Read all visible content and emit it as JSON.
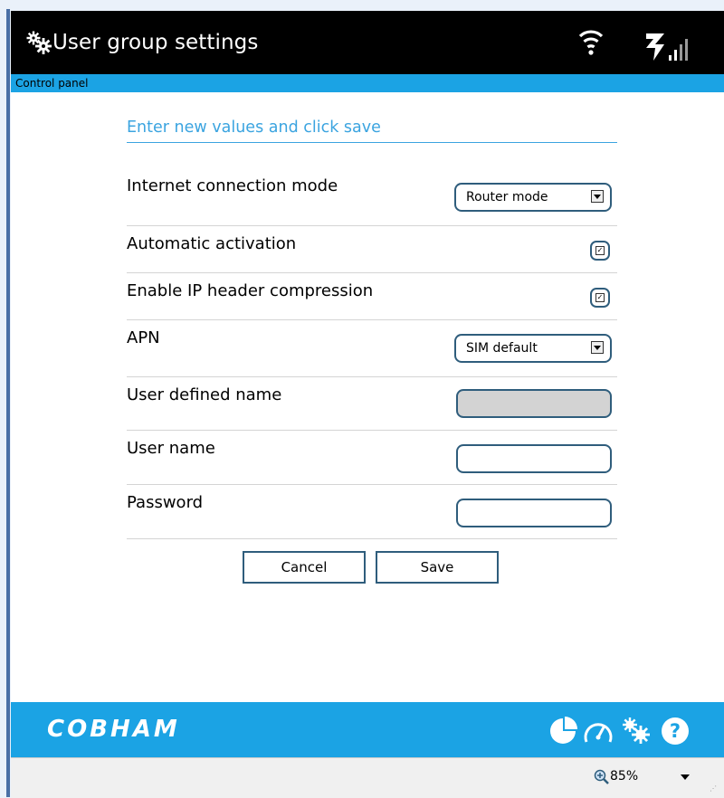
{
  "header": {
    "title": "User group settings",
    "gear_icon": "gear-icon",
    "wifi_icon": "wifi-icon",
    "signal_icon": "signal-strength-icon"
  },
  "control_panel": {
    "label": "Control panel"
  },
  "form": {
    "heading": "Enter new values and click save",
    "internet_mode": {
      "label": "Internet connection mode",
      "value": "Router mode"
    },
    "auto_activation": {
      "label": "Automatic activation",
      "checked": true
    },
    "ip_header_compression": {
      "label": "Enable IP header compression",
      "checked": true
    },
    "apn": {
      "label": "APN",
      "value": "SIM default"
    },
    "user_defined_name": {
      "label": "User defined name",
      "value": "",
      "disabled": true
    },
    "user_name": {
      "label": "User name",
      "value": ""
    },
    "password": {
      "label": "Password",
      "value": ""
    },
    "cancel_label": "Cancel",
    "save_label": "Save"
  },
  "footer": {
    "logo": "COBHAM",
    "icons": [
      "dashboard-pie-icon",
      "speedometer-icon",
      "settings-gear-icon",
      "help-icon"
    ]
  },
  "status_bar": {
    "zoom": "85%"
  },
  "colors": {
    "header": "#000000",
    "accent": "#1ba3e4",
    "heading": "#3ba4e0",
    "control_border": "#2f5d7c"
  }
}
